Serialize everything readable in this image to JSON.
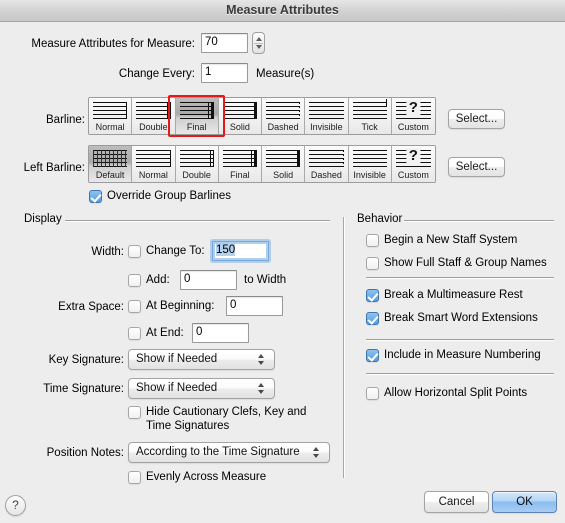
{
  "window": {
    "title": "Measure Attributes"
  },
  "top": {
    "measure_label": "Measure Attributes for Measure:",
    "measure_value": "70",
    "change_every_label": "Change Every:",
    "change_every_value": "1",
    "measures_suffix": "Measure(s)"
  },
  "barline": {
    "label": "Barline:",
    "select_label": "Select...",
    "selected": "Final",
    "options": [
      "Normal",
      "Double",
      "Final",
      "Solid",
      "Dashed",
      "Invisible",
      "Tick",
      "Custom"
    ]
  },
  "left_barline": {
    "label": "Left Barline:",
    "select_label": "Select...",
    "selected": "Default",
    "options": [
      "Default",
      "Normal",
      "Double",
      "Final",
      "Solid",
      "Dashed",
      "Invisible",
      "Custom"
    ]
  },
  "override": {
    "label": "Override Group Barlines",
    "checked": true
  },
  "display": {
    "title": "Display",
    "width_label": "Width:",
    "change_to_label": "Change To:",
    "change_to_checked": false,
    "change_to_value": "150",
    "add_label": "Add:",
    "add_checked": false,
    "add_value": "0",
    "to_width_label": "to Width",
    "extra_space_label": "Extra Space:",
    "at_beginning_label": "At Beginning:",
    "at_beginning_checked": false,
    "at_beginning_value": "0",
    "at_end_label": "At End:",
    "at_end_checked": false,
    "at_end_value": "0",
    "key_signature_label": "Key Signature:",
    "key_signature_value": "Show if Needed",
    "time_signature_label": "Time Signature:",
    "time_signature_value": "Show if Needed",
    "hide_cautionary_line1": "Hide Cautionary Clefs, Key and",
    "hide_cautionary_line2": "Time Signatures",
    "hide_cautionary_checked": false,
    "position_notes_label": "Position Notes:",
    "position_notes_value": "According to the Time Signature",
    "evenly_label": "Evenly Across Measure",
    "evenly_checked": false
  },
  "behavior": {
    "title": "Behavior",
    "items": [
      {
        "label": "Begin a New Staff System",
        "checked": false
      },
      {
        "label": "Show Full Staff & Group Names",
        "checked": false
      },
      {
        "label": "Break a Multimeasure Rest",
        "checked": true
      },
      {
        "label": "Break Smart Word Extensions",
        "checked": true
      },
      {
        "label": "Include in Measure Numbering",
        "checked": true
      },
      {
        "label": "Allow Horizontal Split Points",
        "checked": false
      }
    ]
  },
  "footer": {
    "help_label": "?",
    "cancel_label": "Cancel",
    "ok_label": "OK"
  },
  "colors": {
    "accent": "#4f9de4",
    "selection_ring": "#e81818",
    "window_bg": "#ededed"
  }
}
